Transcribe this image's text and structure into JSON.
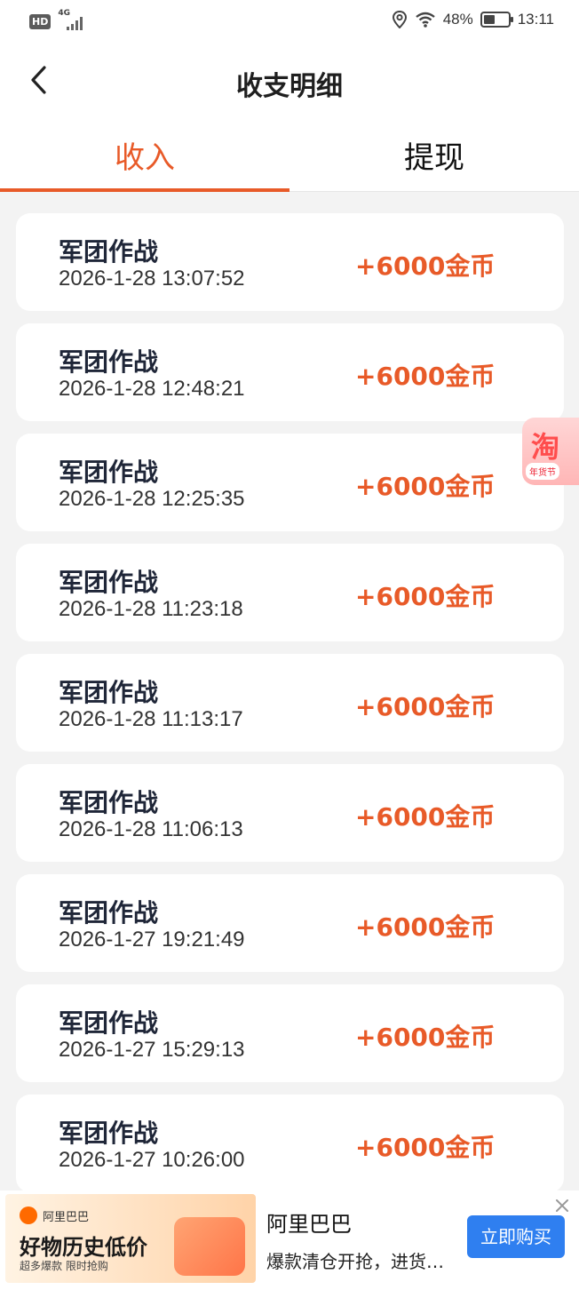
{
  "status_bar": {
    "hd_label": "HD",
    "network_label": "4G",
    "battery_text": "48%",
    "battery_level": 0.48,
    "time": "13:11"
  },
  "header": {
    "title": "收支明细"
  },
  "tabs": [
    {
      "label": "收入",
      "active": true
    },
    {
      "label": "提现",
      "active": false
    }
  ],
  "records": [
    {
      "name": "军团作战",
      "time": "2026-1-28 13:07:52",
      "amount": "+6000金币"
    },
    {
      "name": "军团作战",
      "time": "2026-1-28 12:48:21",
      "amount": "+6000金币"
    },
    {
      "name": "军团作战",
      "time": "2026-1-28 12:25:35",
      "amount": "+6000金币"
    },
    {
      "name": "军团作战",
      "time": "2026-1-28 11:23:18",
      "amount": "+6000金币"
    },
    {
      "name": "军团作战",
      "time": "2026-1-28 11:13:17",
      "amount": "+6000金币"
    },
    {
      "name": "军团作战",
      "time": "2026-1-28 11:06:13",
      "amount": "+6000金币"
    },
    {
      "name": "军团作战",
      "time": "2026-1-27 19:21:49",
      "amount": "+6000金币"
    },
    {
      "name": "军团作战",
      "time": "2026-1-27 15:29:13",
      "amount": "+6000金币"
    },
    {
      "name": "军团作战",
      "time": "2026-1-27 10:26:00",
      "amount": "+6000金币"
    }
  ],
  "floating_ad": {
    "glyph": "淘",
    "tag": "年货节"
  },
  "ad": {
    "logo_text": "阿里巴巴",
    "headline": "好物历史低价",
    "subline": "超多爆款  限时抢购",
    "brand": "阿里巴巴",
    "description": "爆款清仓开抢，进货…",
    "cta": "立即购买"
  },
  "colors": {
    "accent": "#e85a28",
    "cta_blue": "#2f7ff0",
    "background": "#f3f3f3"
  }
}
